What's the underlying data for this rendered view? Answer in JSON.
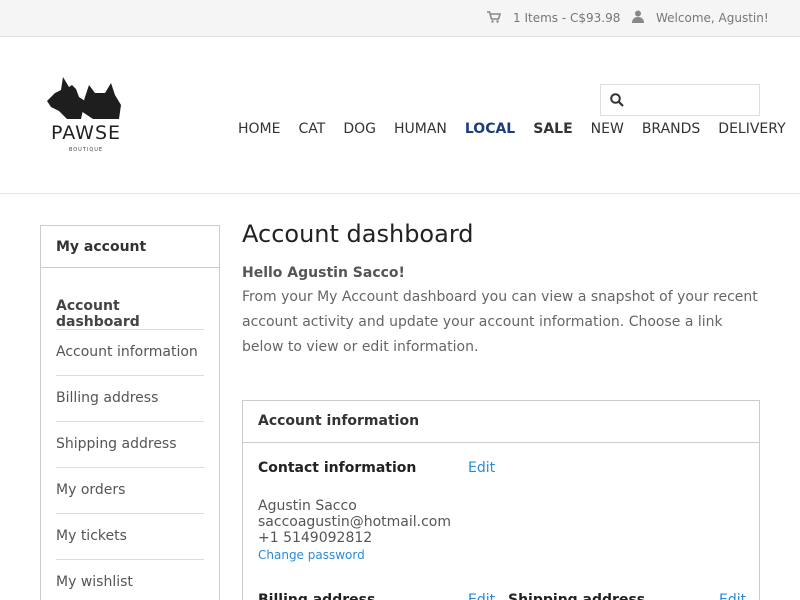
{
  "topbar": {
    "cart_text": "1 Items - C$93.98",
    "welcome_text": "Welcome, Agustin!"
  },
  "header": {
    "logo_text": "PAWSE",
    "logo_sub": "BOUTIQUE",
    "search_placeholder": "",
    "nav": [
      {
        "label": "HOME"
      },
      {
        "label": "CAT"
      },
      {
        "label": "DOG"
      },
      {
        "label": "HUMAN"
      },
      {
        "label": "LOCAL"
      },
      {
        "label": "SALE"
      },
      {
        "label": "NEW"
      },
      {
        "label": "BRANDS"
      },
      {
        "label": "DELIVERY"
      }
    ]
  },
  "sidebar": {
    "title": "My account",
    "items": [
      {
        "label": "Account dashboard"
      },
      {
        "label": "Account information"
      },
      {
        "label": "Billing address"
      },
      {
        "label": "Shipping address"
      },
      {
        "label": "My orders"
      },
      {
        "label": "My tickets"
      },
      {
        "label": "My wishlist"
      }
    ]
  },
  "main": {
    "title": "Account dashboard",
    "hello": "Hello Agustin Sacco!",
    "intro": "From your My Account dashboard you can view a snapshot of your recent account activity and update your account information. Choose a link below to view or edit information.",
    "panel": {
      "title": "Account information",
      "contact_title": "Contact information",
      "contact_edit": "Edit",
      "name": "Agustin Sacco",
      "email": "saccoagustin@hotmail.com",
      "phone": "+1 5149092812",
      "change_password": "Change password",
      "billing_title": "Billing address",
      "billing_edit": "Edit",
      "shipping_title": "Shipping address",
      "shipping_edit": "Edit"
    }
  },
  "colors": {
    "accent_link": "#2a8bd6",
    "local_nav": "#1a3d7c",
    "topbar_bg": "#f5f5f5"
  }
}
